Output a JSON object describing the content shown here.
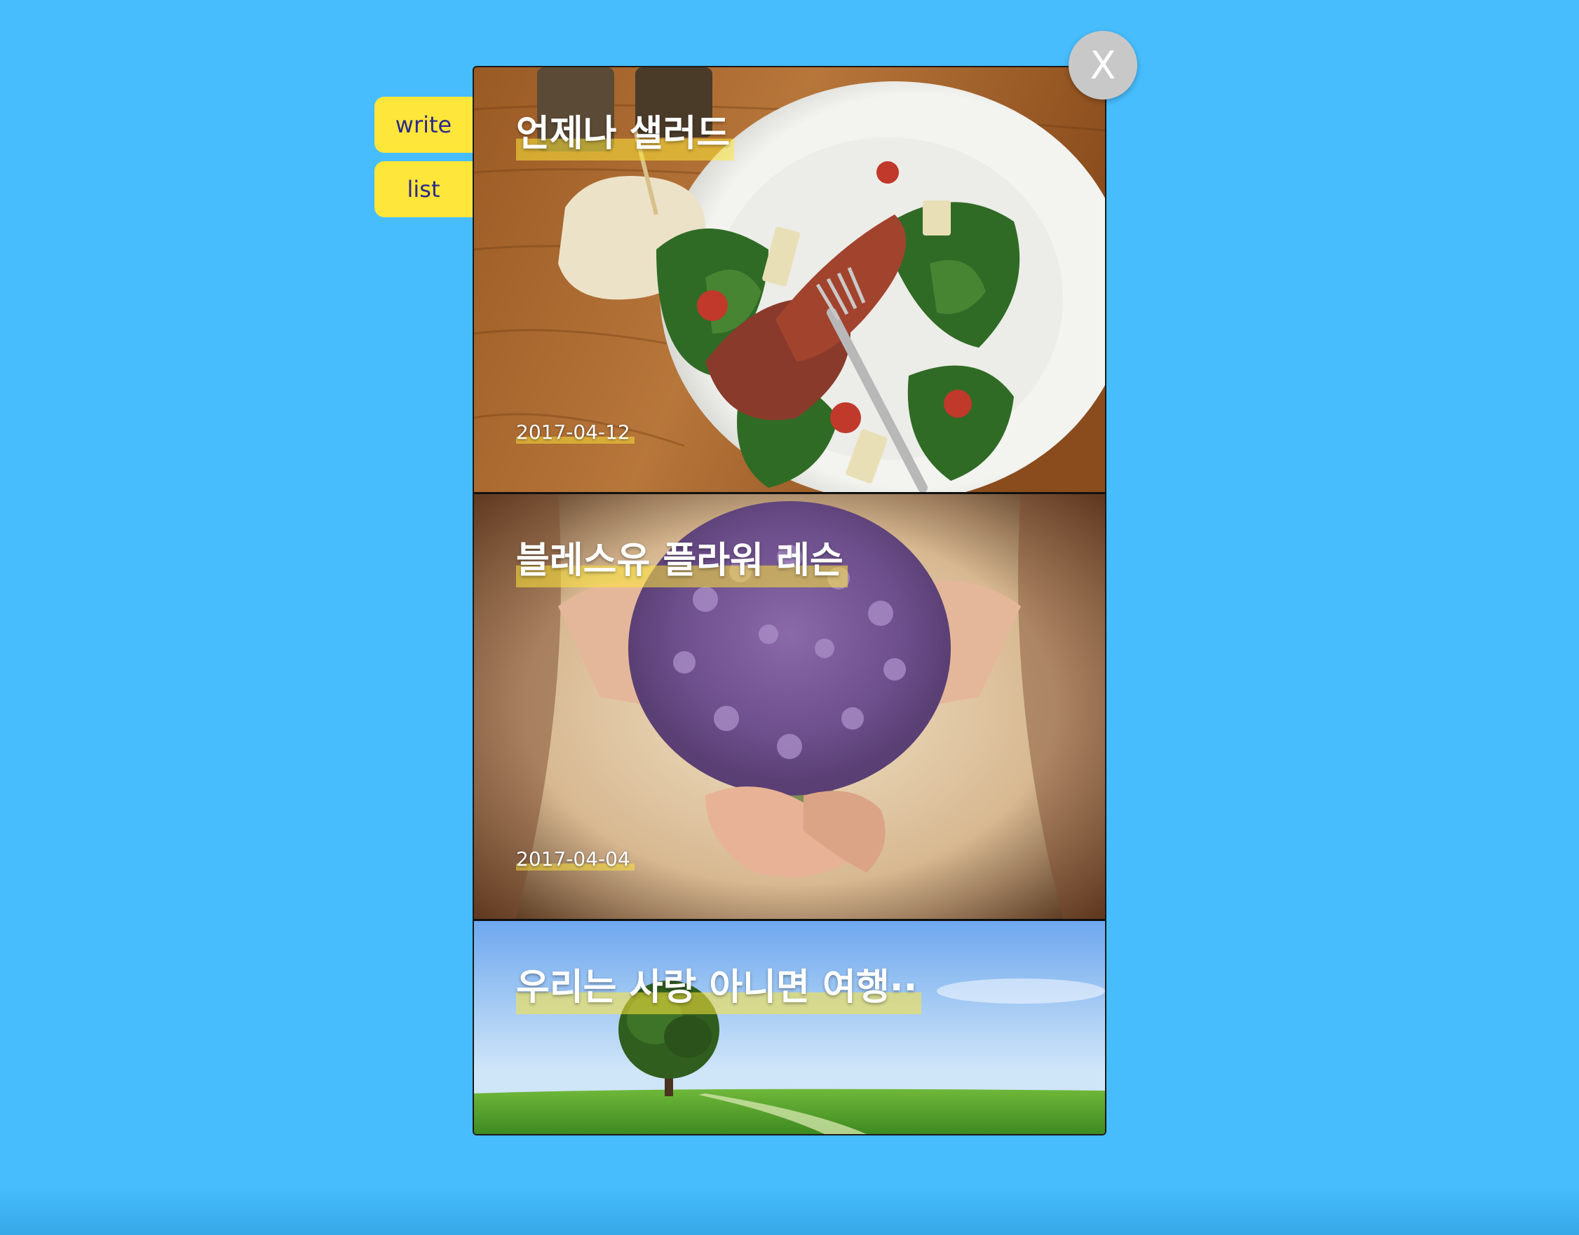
{
  "nav": {
    "write_label": "write",
    "list_label": "list"
  },
  "close_label": "X",
  "posts": [
    {
      "title": "언제나 샐러드",
      "date": "2017-04-12",
      "image": "salad-photo"
    },
    {
      "title": "블레스유 플라워 레슨",
      "date": "2017-04-04",
      "image": "lavender-bouquet-photo"
    },
    {
      "title": "우리는 사랑 아니면 여행··",
      "date": "",
      "image": "tree-field-photo"
    }
  ],
  "colors": {
    "background": "#47bdfd",
    "accent": "#ffe63a",
    "nav_text": "#2b2a8a",
    "close_button": "#c8c8c8"
  }
}
